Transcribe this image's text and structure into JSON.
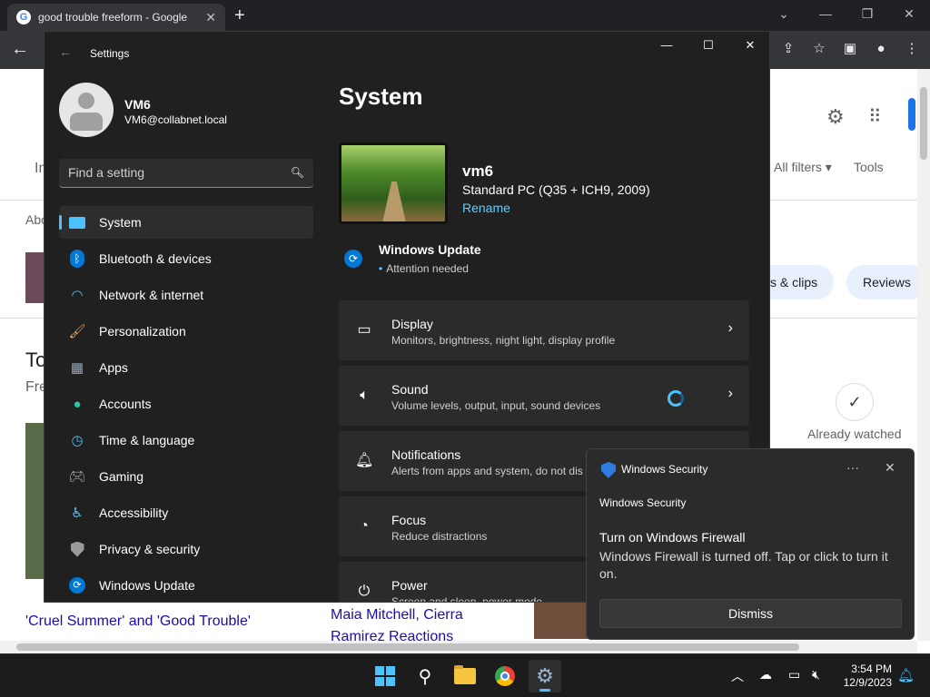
{
  "browser": {
    "tab_title": "good trouble freeform - Google",
    "favicon_letter": "G",
    "page": {
      "filters_label": "All filters",
      "tools_label": "Tools",
      "chip_clips": "s & clips",
      "chip_reviews": "Reviews",
      "already_watched": "Already watched",
      "side_text": [
        "Im",
        "Abo",
        "To",
        "Fre"
      ],
      "result_link_1": "'Cruel Summer' and 'Good Trouble'",
      "result_link_2_line1": "Maia Mitchell, Cierra",
      "result_link_2_line2": "Ramirez Reactions"
    }
  },
  "settings": {
    "window_title": "Settings",
    "user": {
      "name": "VM6",
      "email": "VM6@collabnet.local"
    },
    "search_placeholder": "Find a setting",
    "nav": [
      {
        "label": "System",
        "icon": "monitor-icon",
        "active": true
      },
      {
        "label": "Bluetooth & devices",
        "icon": "bluetooth-icon"
      },
      {
        "label": "Network & internet",
        "icon": "wifi-icon"
      },
      {
        "label": "Personalization",
        "icon": "brush-icon"
      },
      {
        "label": "Apps",
        "icon": "apps-icon"
      },
      {
        "label": "Accounts",
        "icon": "person-icon"
      },
      {
        "label": "Time & language",
        "icon": "globe-clock-icon"
      },
      {
        "label": "Gaming",
        "icon": "gamepad-icon"
      },
      {
        "label": "Accessibility",
        "icon": "accessibility-icon"
      },
      {
        "label": "Privacy & security",
        "icon": "shield-icon"
      },
      {
        "label": "Windows Update",
        "icon": "update-icon"
      }
    ],
    "main": {
      "page_title": "System",
      "device_name": "vm6",
      "device_model": "Standard PC (Q35 + ICH9, 2009)",
      "rename_label": "Rename",
      "windows_update": {
        "title": "Windows Update",
        "status": "Attention needed"
      },
      "cards": [
        {
          "title": "Display",
          "subtitle": "Monitors, brightness, night light, display profile",
          "icon": "display-icon"
        },
        {
          "title": "Sound",
          "subtitle": "Volume levels, output, input, sound devices",
          "icon": "speaker-icon"
        },
        {
          "title": "Notifications",
          "subtitle": "Alerts from apps and system, do not dis",
          "icon": "bell-icon"
        },
        {
          "title": "Focus",
          "subtitle": "Reduce distractions",
          "icon": "focus-icon"
        },
        {
          "title": "Power",
          "subtitle": "Screen and sleep, power mode",
          "icon": "power-icon"
        }
      ]
    }
  },
  "toast": {
    "app_name": "Windows Security",
    "header": "Windows Security",
    "title": "Turn on Windows Firewall",
    "body": "Windows Firewall is turned off. Tap or click to turn it on.",
    "dismiss_label": "Dismiss"
  },
  "taskbar": {
    "time": "3:54 PM",
    "date": "12/9/2023",
    "apps": [
      "start-icon",
      "search-icon",
      "file-explorer-icon",
      "chrome-icon",
      "settings-icon"
    ]
  },
  "colors": {
    "accent": "#4cc2ff",
    "settings_bg": "#202020",
    "card_bg": "#2b2b2b",
    "link": "#60cdff"
  }
}
